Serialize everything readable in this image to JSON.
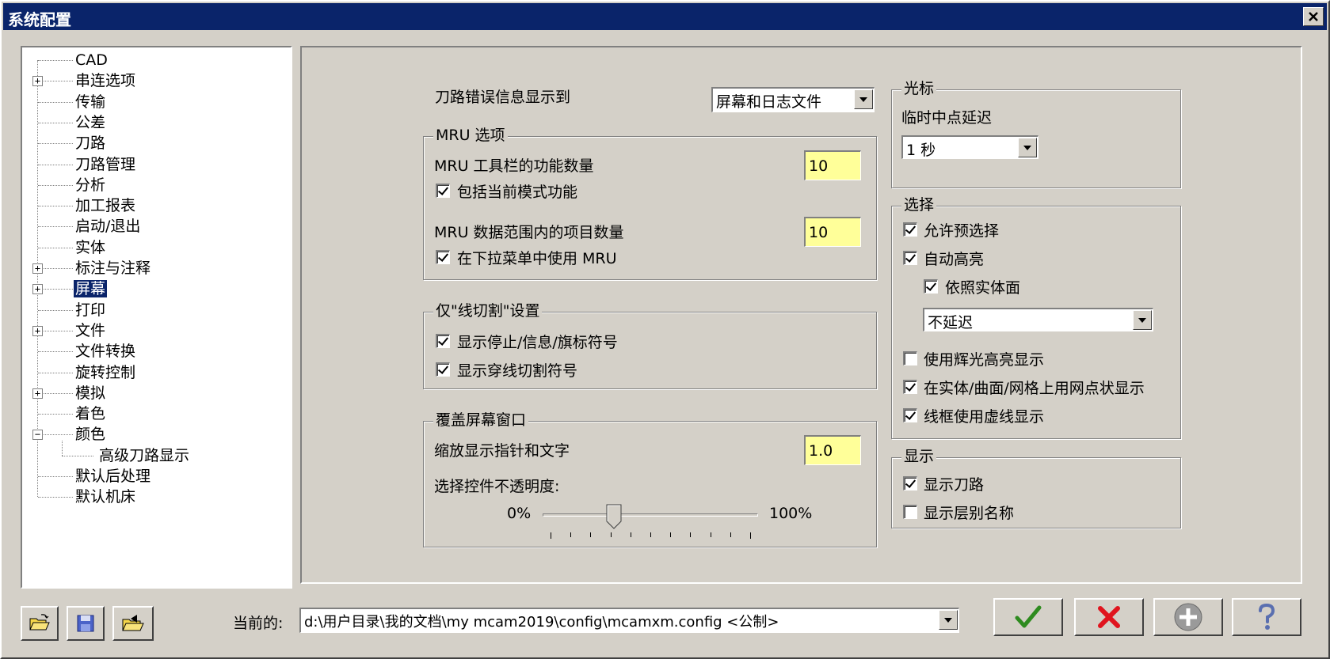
{
  "window": {
    "title": "系统配置"
  },
  "tree": {
    "items": [
      {
        "label": "CAD",
        "expander": ""
      },
      {
        "label": "串连选项",
        "expander": "+"
      },
      {
        "label": "传输",
        "expander": ""
      },
      {
        "label": "公差",
        "expander": ""
      },
      {
        "label": "刀路",
        "expander": ""
      },
      {
        "label": "刀路管理",
        "expander": ""
      },
      {
        "label": "分析",
        "expander": ""
      },
      {
        "label": "加工报表",
        "expander": ""
      },
      {
        "label": "启动/退出",
        "expander": ""
      },
      {
        "label": "实体",
        "expander": ""
      },
      {
        "label": "标注与注释",
        "expander": "+"
      },
      {
        "label": "屏幕",
        "expander": "+",
        "selected": true
      },
      {
        "label": "打印",
        "expander": ""
      },
      {
        "label": "文件",
        "expander": "+"
      },
      {
        "label": "文件转换",
        "expander": ""
      },
      {
        "label": "旋转控制",
        "expander": ""
      },
      {
        "label": "模拟",
        "expander": "+"
      },
      {
        "label": "着色",
        "expander": ""
      },
      {
        "label": "颜色",
        "expander": "−"
      },
      {
        "label": "高级刀路显示",
        "expander": "",
        "child": true
      },
      {
        "label": "默认后处理",
        "expander": ""
      },
      {
        "label": "默认机床",
        "expander": ""
      }
    ]
  },
  "screen": {
    "error_label": "刀路错误信息显示到",
    "error_value": "屏幕和日志文件",
    "mru": {
      "title": "MRU 选项",
      "toolbar_count_label": "MRU 工具栏的功能数量",
      "toolbar_count": "10",
      "include_mode_label": "包括当前模式功能",
      "data_count_label": "MRU 数据范围内的项目数量",
      "data_count": "10",
      "dropdown_mru_label": "在下拉菜单中使用 MRU"
    },
    "wire": {
      "title": "仅\"线切割\"设置",
      "show_stop_label": "显示停止/信息/旗标符号",
      "show_thread_label": "显示穿线切割符号"
    },
    "overlay": {
      "title": "覆盖屏幕窗口",
      "scale_label": "缩放显示指针和文字",
      "scale_value": "1.0",
      "opacity_label": "选择控件不透明度:",
      "min_label": "0%",
      "max_label": "100%",
      "opacity_value": 0.33
    },
    "cursor": {
      "title": "光标",
      "delay_label": "临时中点延迟",
      "delay_value": "1 秒"
    },
    "selection": {
      "title": "选择",
      "allow_preselect": "允许预选择",
      "auto_highlight": "自动高亮",
      "by_solid_face": "依照实体面",
      "delay_value": "不延迟",
      "glow_highlight": "使用辉光高亮显示",
      "dot_display": "在实体/曲面/网格上用网点状显示",
      "wireframe_dashed": "线框使用虚线显示"
    },
    "display": {
      "title": "显示",
      "show_toolpath": "显示刀路",
      "show_level_names": "显示层别名称"
    }
  },
  "footer": {
    "current_label": "当前的:",
    "current_value": "d:\\用户目录\\我的文档\\my mcam2019\\config\\mcamxm.config <公制>"
  },
  "colors": {
    "titlebar": "#0a246a",
    "input_highlight": "#ffff99",
    "ok_green": "#2e8b1f",
    "cancel_red": "#e0141e"
  }
}
